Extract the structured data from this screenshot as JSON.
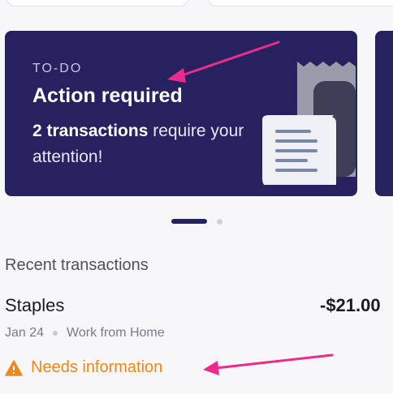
{
  "todo_card": {
    "eyebrow": "TO-DO",
    "title": "Action required",
    "count_text": "2 transactions",
    "rest_text": " require your attention!",
    "illustration": "receipt-icon"
  },
  "carousel": {
    "pages": 2,
    "active_index": 0
  },
  "recent": {
    "section_title": "Recent transactions",
    "transactions": [
      {
        "merchant": "Staples",
        "amount": "-$21.00",
        "date": "Jan 24",
        "category": "Work from Home",
        "status": "Needs information",
        "status_icon": "warning-icon"
      }
    ]
  },
  "colors": {
    "card_bg": "#262260",
    "status": "#f0871c",
    "annotation_arrow": "#ee2a8a"
  }
}
